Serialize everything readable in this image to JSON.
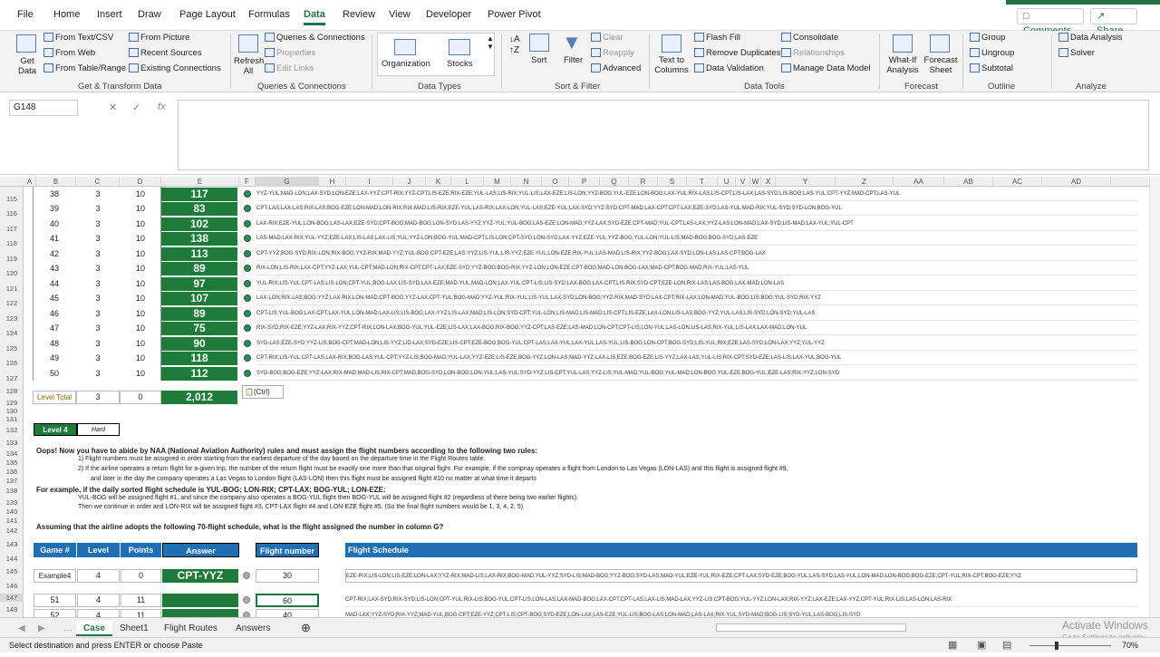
{
  "menu_tabs": [
    "File",
    "Home",
    "Insert",
    "Draw",
    "Page Layout",
    "Formulas",
    "Data",
    "Review",
    "View",
    "Developer",
    "Power Pivot"
  ],
  "active_tab": "Data",
  "top_buttons": {
    "comments": "Comments",
    "share": "Share"
  },
  "ribbon": {
    "get_data": "Get Data",
    "from_text_csv": "From Text/CSV",
    "from_web": "From Web",
    "from_table_range": "From Table/Range",
    "from_picture": "From Picture",
    "recent_sources": "Recent Sources",
    "existing_connections": "Existing Connections",
    "group1_label": "Get & Transform Data",
    "refresh_all": "Refresh All",
    "queries_connections": "Queries & Connections",
    "properties": "Properties",
    "edit_links": "Edit Links",
    "group2_label": "Queries & Connections",
    "organization": "Organization",
    "stocks": "Stocks",
    "group3_label": "Data Types",
    "sort": "Sort",
    "filter": "Filter",
    "clear": "Clear",
    "reapply": "Reapply",
    "advanced": "Advanced",
    "group4_label": "Sort & Filter",
    "text_to_columns": "Text to Columns",
    "flash_fill": "Flash Fill",
    "remove_duplicates": "Remove Duplicates",
    "data_validation": "Data Validation",
    "consolidate": "Consolidate",
    "relationships": "Relationships",
    "manage_data_model": "Manage Data Model",
    "group5_label": "Data Tools",
    "what_if": "What-If Analysis",
    "forecast_sheet": "Forecast Sheet",
    "group6_label": "Forecast",
    "group": "Group",
    "ungroup": "Ungroup",
    "subtotal": "Subtotal",
    "group7_label": "Outline",
    "data_analysis": "Data Analysis",
    "solver": "Solver",
    "group8_label": "Analyze"
  },
  "formula_bar": {
    "name_box": "G148",
    "formula": ""
  },
  "columns": [
    "A",
    "B",
    "C",
    "D",
    "E",
    "F",
    "G",
    "H",
    "I",
    "J",
    "K",
    "L",
    "M",
    "N",
    "O",
    "P",
    "Q",
    "R",
    "S",
    "T",
    "U",
    "V",
    "W",
    "X",
    "Y",
    "Z",
    "AA",
    "AB",
    "AC",
    "AD"
  ],
  "row_numbers": [
    "115",
    "116",
    "117",
    "118",
    "119",
    "120",
    "121",
    "122",
    "123",
    "124",
    "125",
    "126",
    "127",
    "128",
    "129",
    "130",
    "131",
    "132",
    "133",
    "134",
    "135",
    "136",
    "137",
    "138",
    "139",
    "140",
    "141",
    "142",
    "143",
    "144",
    "145",
    "146",
    "147",
    "148",
    "149"
  ],
  "level3_rows": [
    {
      "game": "38",
      "level": "3",
      "points": "10",
      "answer": "117",
      "schedule": "YYZ-YUL;MAD-LON;LAX-SYD;LON-EZE;LAX-YYZ;CPT-RIX;YYZ-CPT;LIS-EZE;RIX-EZE;YUL-LAS;LIS-RIX;YUL-LIS;LAX-EZE;LIS-LON;YYZ-BOG;YUL-EZE;LON-BOG;LAX-YUL;RIX-LAS;LIS-CPT;LIS-LAX;LAS-SYD;LIS-BOG;LAS-YUL;CPT-YYZ;MAD-CPT;LAS-YUL"
    },
    {
      "game": "39",
      "level": "3",
      "points": "10",
      "answer": "83",
      "schedule": "CPT-LAS;LAX-LAS;RIX-LAS;BOG-EZE;LON-MAD;LON-RIX;RIX-MAD;LIS-RIX;EZE-YUL;LAS-RIX;LAX-LON;YUL-LAS;EZE-YUL;LAX-SYD;YYZ-SYD;CPT-MAD;LAX-CPT;CPT-LAX;EZE-SYD;LAS-YUL;MAD-RIX;YUL-SYD;SYD-LON;BOG-YUL"
    },
    {
      "game": "40",
      "level": "3",
      "points": "10",
      "answer": "102",
      "schedule": "LAX-RIX;EZE-YUL;LON-BOG;LAS-LAX;EZE-SYD;CPT-BOG;MAD-BOG;LON-SYD;LAS-YYZ;YYZ-YUL;YUL-BOG;LAS-EZE;LON-MAD;YYZ-LAX;SYD-EZE;CPT-MAD;YUL-CPT;LAS-LAX;YYZ-LAS;LON-MAD;LAX-SYD;LIS-MAD;LAX-YUL;YUL-CPT"
    },
    {
      "game": "41",
      "level": "3",
      "points": "10",
      "answer": "138",
      "schedule": "LAS-MAD;LAX-RIX;YUL-YYZ;EZE-LAX;LIS-LAS;LAX-LIS;YUL;YYZ-LON;BOG-YUL;MAD-CPT;LIS-LON;CPT-SYD;LON-SYD;LAX-YYZ;EZE-YUL;YYZ-BOG;YUL-LON;YUL-LIS;MAD-BOG;BOG-SYD;LAS-EZE"
    },
    {
      "game": "42",
      "level": "3",
      "points": "10",
      "answer": "113",
      "schedule": "CPT-YYZ;BOG-SYD;RIX-LON;RIX-BOG;YYZ-RIX;MAD-YYZ;YUL-BOG;CPT-EZE;LAS-YYZ;LIS-YUL;LIS-YYZ;EZE-YUL;LON-EZE;RIX-YUL;LAS-MAD;LIS-RIX;YYZ-BOG;LAX-SYD;LON-LAS;LAS-CPT;BOG-LAX"
    },
    {
      "game": "43",
      "level": "3",
      "points": "10",
      "answer": "89",
      "schedule": "RIX-LON;LIS-RIX;LAX-CPT;YYZ-LAX;YUL-CPT;MAD-LON;RIX-CPT;CPT-LAX;EZE-SYD;YYZ-BOG;BOG-RIX;YYZ-LON;LON-EZE;CPT-BOG;MAD-LON;BOG-LAX;MAD-CPT;BOG-MAD;RIX-YUL;LAS-YUL"
    },
    {
      "game": "44",
      "level": "3",
      "points": "10",
      "answer": "97",
      "schedule": "YUL-RIX;LIS-YUL;CPT-LAS;LIS-LON;CPT-YUL;BOG-LAX;LIS-SYD;LAX-EZE;MAD-YUL;MAD-LON;LAX-YUL;CPT-LIS;LIS-SYD;LAX-BOG;LAX-CPT;LIS-RIX;SYD-CPT;EZE-LON;RIX-LAS;LAS-BOG;LAX-MAD;LON-LAS"
    },
    {
      "game": "45",
      "level": "3",
      "points": "10",
      "answer": "107",
      "schedule": "LAX-LON;RIX-LAS;BOG-YYZ;LAX-RIX;LON-MAD;CPT-BOG;YYZ-LAX;CPT-YUL;BOG-MAD;YYZ-YUL;RIX-YUL;LIS-YUL;LAX-SYD;LON-BOG;YYZ-RIX;MAD-SYD;LAX-CPT;RIX-LAX;LON-MAD;YUL-BOG;LIS-BOG;YUL-SYD;RIX-YYZ"
    },
    {
      "game": "46",
      "level": "3",
      "points": "10",
      "answer": "89",
      "schedule": "CPT-LIS;YUL-BOG;LAX-CPT;LAX-YUL;LON-MAD;LAX-LIS;LIS-BOG;LAX-YYZ;LIS-LAX;MAD;LIS-LON;SYD-CPT;YUL-LON;LIS-MAD;LIS-MAD;LIS-CPT;LIS-EZE;LAX-LON;LIS-LAS;BOG-YYZ;YUL-LAS;LIS-SYD;LON-SYD;YUL-LAS"
    },
    {
      "game": "47",
      "level": "3",
      "points": "10",
      "answer": "75",
      "schedule": "RIX-SYD;RIX-EZE;YYZ-LAX;RIX-YYZ;CPT-RIX;LON-LAX;BOG-YUL;YUL-EZE;LIS-LAX;LAX-BOG;RIX-BOG;YYZ-CPT;LAS-EZE;LAS-MAD;LON-CPT;CPT-LIS;LON-YUL;LAS-LON;LIS-LAS;RIX-YUL;LIS-LAX;LAX-MAD;LON-YUL"
    },
    {
      "game": "48",
      "level": "3",
      "points": "10",
      "answer": "90",
      "schedule": "SYD-LAS;EZE-SYD;YYZ-LIS;BOG-CPT;MAD-LON;LIS-YYZ;LID-LAX;SYD-EZE;LIS-CPT;EZE-BOG;BOG-YUL;CPT-LAS;LAX-YUL;LAX-YUL;LAS-YUL;LIS-BOG;LON-CPT;BOG-SYD;LIS-YUL;RIX;EZE;LAS-SYD;LON-LAX;YYZ;YUL-YYZ"
    },
    {
      "game": "49",
      "level": "3",
      "points": "10",
      "answer": "118",
      "schedule": "CPT-RIX;LIS-YUL;CPT-LAS;LAX-RIX;BOG-LAS;YUL-CPT;YYZ-LIS;BOG-MAD;YUL-LAX;YYZ-EZE;LIS-EZE;BOG-YYZ;LON-LAS;MAD-YYZ;LAX-LIS;EZE;BOG-EZE;LIS-YYZ;LAX-LAS;YUL-LIS;RIX-CPT;SYD-EZE;LAS-LIS;LAX-YUL;BOG-YUL"
    },
    {
      "game": "50",
      "level": "3",
      "points": "10",
      "answer": "112",
      "schedule": "SYD-BOG;BOG-EZE;YYZ-LAX;RIX-MAD;MAD-LIS;RIX-CPT;MAD;BOG-SYD;LON-BOG;LON-YUL;LAS-YUL;SYD-YYZ;LIS-CPT;YUL-LAS;YYZ-LIS;YUL-MAD;YUL-BOG;YUL-MAD;LON-BOG;YUL-EZE;BOG-YUL;EZE-LAS;RIX-YYZ;LON-SYD"
    }
  ],
  "level_total": {
    "label": "Level Total",
    "level": "3",
    "points": "0",
    "answer": "2,012"
  },
  "paste_options": "(Ctrl)",
  "level4": {
    "label": "Level 4",
    "difficulty": "Hard"
  },
  "instructions": {
    "line1": "Oops! Now you have to abide by NAA (National Aviation Authority) rules and must assign the flight numbers according to the following two rules:",
    "line2": "1) Flight numbers must be assigned in order starting from the earliest departure of the day based on the departure time in the Flight Routes table.",
    "line3": "2) If the airline operates a return flight for a given trip, the number of the return flight must be exactly one more than that original flight. For example, if the compnay operates a flight from London to Las Vegas (LON-LAS) and this flight is assigned flight #9,",
    "line4": "and later in the day the company operates a Las Vegas to London flight (LAS-LON) then this flight must be assigned flight #10 no matter at what time it departs",
    "line5": "For example, if the daily sorted flight schedule is YUL-BOG; LON-RIX; CPT-LAX; BOG-YUL; LON-EZE:",
    "line6": "YUL-BOG will be assigned flight #1, and since the company also operates a BOG-YUL flight then BOG-YUL will be assigned flight #2 (regardless of there being two earlier flights).",
    "line7": "Then we continue in order and LON-RIX will be assigned flight #3, CPT-LAX flight #4 and LON-EZE flight #5. (So the final flight numbers would be 1, 3, 4, 2, 5)",
    "line8": "Assuming that the airline adopts the following 70-flight schedule, what is the flight assigned the number in column G?"
  },
  "headers": {
    "game": "Game #",
    "level": "Level",
    "points": "Points",
    "answer": "Answer",
    "flight_number": "Flight number",
    "flight_schedule": "Flight Schedule"
  },
  "example4": {
    "game": "Example4",
    "level": "4",
    "points": "0",
    "answer": "CPT-YYZ",
    "flight_number": "30",
    "schedule": "EZE-RIX;LIS-LON;LIS-EZE;LON-LAX;YYZ-RIX;MAD-LIS;LAX-RIX;BOG-MAD;YUL-YYZ;SYD-LIS;MAD-BOG;YYZ-BOG;SYD-LAS;MAD-YUL;EZE-YUL;RIX-EZE;CPT-LAX;SYD-EZE;BOG-YUL;LAS-SYD;LAS-YUL;LON-MAD;LON-BOG;BOG-EZE;CPT-YUL;RIX-CPT;BOG-EZE;YYZ"
  },
  "level4_rows": [
    {
      "game": "51",
      "level": "4",
      "points": "11",
      "answer": "",
      "flight_number": "60",
      "schedule": "CPT-RIX;LAX-SYD;RIX-SYD;LIS-LON;CPT-YUL;RIX-LIS;BOG-YUL;CPT-LIS;LON-LAS;LAX-MAD-BOG;LAX-CPT;CPT-LAS;LAX-LIS;MAD-LAX;YYZ-LIS;CPT-BOG;YUL-YYZ;LON-LAX;RIX-YYZ;LAX-EZE;LAX-YYZ;CPT-YUL;RIX-LIS;LAS-LON;LAS-RIX"
    },
    {
      "game": "52",
      "level": "4",
      "points": "11",
      "answer": "",
      "flight_number": "40",
      "schedule": "MAD-LAX;YYZ-SYD;RIX-YYZ;MAD-YUL;BOG-CPT;EZE-YYZ;CPT-LIS;CPT-BOG;SYD-EZE;LON-LAX;LAS-EZE;YUL-LIS;BOG-LAS;LON-MAD;LAS-LAX;RIX-YUL;SYD-MAD;BOG-LIS;SYD-YUL;LAS-BOG;LIS-SYD"
    }
  ],
  "sheet_tabs": [
    "Case",
    "Sheet1",
    "Flight Routes",
    "Answers"
  ],
  "active_sheet": "Case",
  "status": {
    "message": "Select destination and press ENTER or choose Paste",
    "zoom": "70%"
  },
  "watermark": {
    "line1": "Activate Windows",
    "line2": "Go to Settings to activate Windows."
  }
}
